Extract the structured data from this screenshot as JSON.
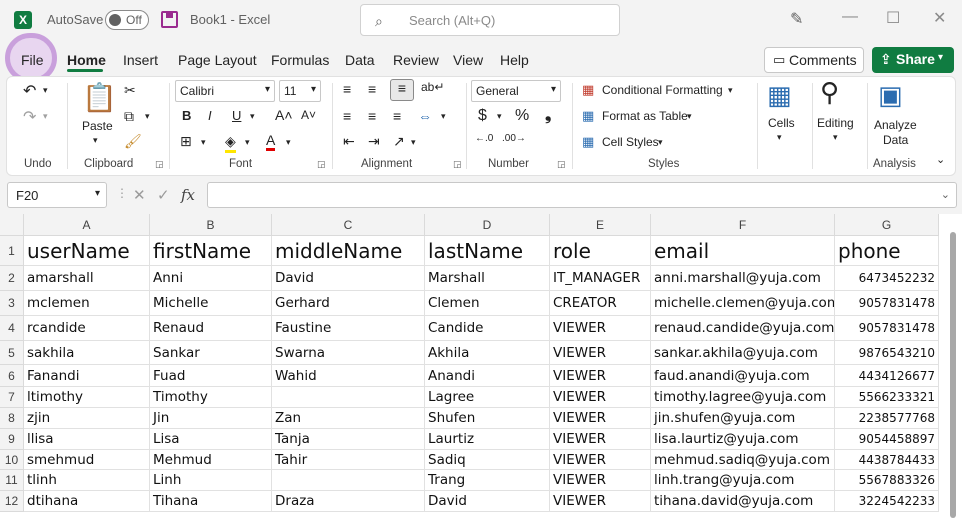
{
  "titlebar": {
    "app_icon": "excel-logo",
    "app_letter": "X",
    "autosave_label": "AutoSave",
    "autosave_state": "Off",
    "doc_title": "Book1  -  Excel",
    "search_placeholder": "Search (Alt+Q)"
  },
  "tabs": [
    {
      "label": "File"
    },
    {
      "label": "Home"
    },
    {
      "label": "Insert"
    },
    {
      "label": "Page Layout"
    },
    {
      "label": "Formulas"
    },
    {
      "label": "Data"
    },
    {
      "label": "Review"
    },
    {
      "label": "View"
    },
    {
      "label": "Help"
    }
  ],
  "active_tab": "Home",
  "actions": {
    "comments": "Comments",
    "share": "Share"
  },
  "ribbon": {
    "groups": [
      "Undo",
      "Clipboard",
      "Font",
      "Alignment",
      "Number",
      "Styles",
      "Cells",
      "Editing",
      "Analysis"
    ],
    "paste": "Paste",
    "font_name": "Calibri",
    "font_size": "11",
    "number_format": "General",
    "conditional_formatting": "Conditional Formatting",
    "format_as_table": "Format as Table",
    "cell_styles": "Cell Styles",
    "cells": "Cells",
    "editing": "Editing",
    "analyze_data_1": "Analyze",
    "analyze_data_2": "Data",
    "accent_color": "#107c41"
  },
  "formula_bar": {
    "name_box": "F20",
    "fx": "fx",
    "value": ""
  },
  "sheet": {
    "columns": [
      "A",
      "B",
      "C",
      "D",
      "E",
      "F",
      "G"
    ],
    "rows": [
      "1",
      "2",
      "3",
      "4",
      "5",
      "6",
      "7",
      "8",
      "9",
      "10",
      "11",
      "12"
    ],
    "header": [
      "userName",
      "firstName",
      "middleName",
      "lastName",
      "role",
      "email",
      "phone"
    ],
    "data": [
      [
        "amarshall",
        "Anni",
        "David",
        "Marshall",
        "IT_MANAGER",
        "anni.marshall@yuja.com",
        "6473452232"
      ],
      [
        "mclemen",
        "Michelle",
        "Gerhard",
        "Clemen",
        "CREATOR",
        "michelle.clemen@yuja.com",
        "9057831478"
      ],
      [
        "rcandide",
        "Renaud",
        "Faustine",
        "Candide",
        "VIEWER",
        "renaud.candide@yuja.com",
        "9057831478"
      ],
      [
        "sakhila",
        "Sankar",
        "Swarna",
        "Akhila",
        "VIEWER",
        "sankar.akhila@yuja.com",
        "9876543210"
      ],
      [
        "Fanandi",
        "Fuad",
        "Wahid",
        "Anandi",
        "VIEWER",
        "faud.anandi@yuja.com",
        "4434126677"
      ],
      [
        "ltimothy",
        "Timothy",
        "",
        "Lagree",
        "VIEWER",
        "timothy.lagree@yuja.com",
        "5566233321"
      ],
      [
        "zjin",
        "Jin",
        "Zan",
        "Shufen",
        "VIEWER",
        "jin.shufen@yuja.com",
        "2238577768"
      ],
      [
        "llisa",
        "Lisa",
        "Tanja",
        "Laurtiz",
        "VIEWER",
        "lisa.laurtiz@yuja.com",
        "9054458897"
      ],
      [
        "smehmud",
        "Mehmud",
        "Tahir",
        "Sadiq",
        "VIEWER",
        "mehmud.sadiq@yuja.com",
        "4438784433"
      ],
      [
        "tlinh",
        "Linh",
        "",
        "Trang",
        "VIEWER",
        "linh.trang@yuja.com",
        "5567883326"
      ],
      [
        "dtihana",
        "Tihana",
        "Draza",
        "David",
        "VIEWER",
        "tihana.david@yuja.com",
        "3224542233"
      ]
    ]
  }
}
